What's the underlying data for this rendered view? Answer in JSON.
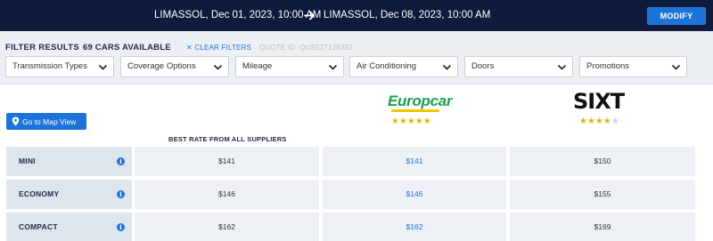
{
  "search": {
    "pickup": "LIMASSOL, Dec 01, 2023, 10:00 AM",
    "dropoff": "LIMASSOL, Dec 08, 2023, 10:00 AM",
    "modify_label": "MODIFY"
  },
  "filters": {
    "title": "FILTER RESULTS",
    "count": "69 CARS AVAILABLE",
    "clear_label": "CLEAR FILTERS",
    "quote_id": "QUOTE ID: QUS527128392",
    "dropdowns": [
      {
        "label": "Transmission Types"
      },
      {
        "label": "Coverage Options"
      },
      {
        "label": "Mileage"
      },
      {
        "label": "Air Conditioning"
      },
      {
        "label": "Doors"
      },
      {
        "label": "Promotions"
      }
    ]
  },
  "map_button_label": "Go to Map View",
  "best_rate_label": "BEST RATE FROM ALL SUPPLIERS",
  "suppliers": [
    {
      "name": "Europcar",
      "rating": 5,
      "accent": "#16a24c"
    },
    {
      "name": "SIXT",
      "rating": 4,
      "accent": "#111111"
    }
  ],
  "rows": [
    {
      "category": "MINI",
      "best": "$141",
      "europcar": "$141",
      "sixt": "$150"
    },
    {
      "category": "ECONOMY",
      "best": "$146",
      "europcar": "$146",
      "sixt": "$155"
    },
    {
      "category": "COMPACT",
      "best": "$162",
      "europcar": "$162",
      "sixt": "$169"
    }
  ],
  "colors": {
    "header_bg": "#0f1b3d",
    "accent_blue": "#1d74d8",
    "filter_bg": "#ecf0f4",
    "star_gold": "#e3b400"
  }
}
